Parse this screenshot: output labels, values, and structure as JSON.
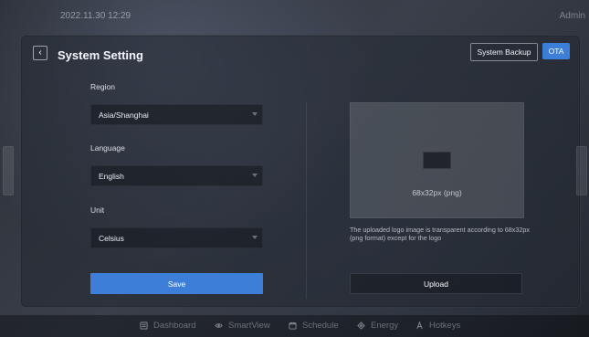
{
  "status_bar": {
    "datetime": "2022.11.30   12:29",
    "user": "Admin"
  },
  "header": {
    "title": "System Setting",
    "back_icon": "chevron-left-icon",
    "buttons": {
      "system_backup": "System Backup",
      "ota": "OTA"
    }
  },
  "form": {
    "region": {
      "label": "Region",
      "value": "Asia/Shanghai"
    },
    "language": {
      "label": "Language",
      "value": "English"
    },
    "unit": {
      "label": "Unit",
      "value": "Celsius"
    },
    "save_label": "Save"
  },
  "logo": {
    "size_hint": "68x32px  (png)",
    "note": "The uploaded logo image is transparent according to 68x32px (png format) except for the logo",
    "upload_label": "Upload"
  },
  "bottom_nav": [
    {
      "key": "dashboard",
      "label": "Dashboard",
      "icon": "dashboard-icon"
    },
    {
      "key": "smartview",
      "label": "SmartView",
      "icon": "eye-icon"
    },
    {
      "key": "schedule",
      "label": "Schedule",
      "icon": "calendar-icon"
    },
    {
      "key": "energy",
      "label": "Energy",
      "icon": "energy-icon"
    },
    {
      "key": "hotkeys",
      "label": "Hotkeys",
      "icon": "hotkeys-icon"
    }
  ],
  "colors": {
    "accent": "#3d7fd8"
  }
}
